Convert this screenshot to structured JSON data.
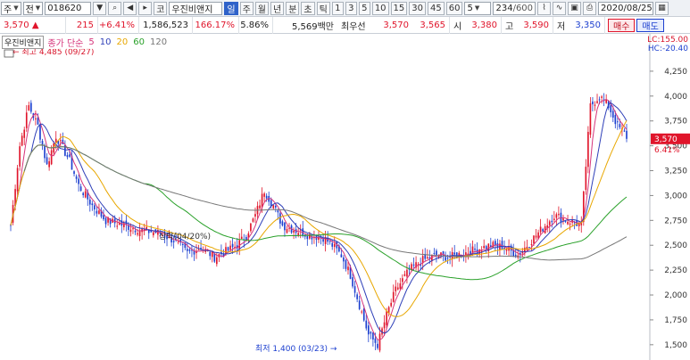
{
  "toolbar": {
    "market": "주",
    "stock_type": "전",
    "code": "018620",
    "name_prefix": "코",
    "name": "우진비앤지",
    "period_active": "일",
    "periods": [
      "주",
      "월",
      "년",
      "분",
      "초",
      "틱"
    ],
    "minutes": [
      "1",
      "3",
      "5",
      "10",
      "15",
      "30",
      "45",
      "60"
    ],
    "interval_value": "5",
    "count": "234",
    "count_total": "/600",
    "date": "2020/08/25"
  },
  "quote": {
    "price": "3,570",
    "direction": "▲",
    "change": "215",
    "change_pct": "+6.41%",
    "volume": "1,586,523",
    "volume_ratio": "166.17%",
    "turnover": "5.86%",
    "amount": "5,569백만",
    "best_label": "최우선",
    "ask": "3,570",
    "bid": "3,565",
    "open_label": "시",
    "open": "3,380",
    "high_label": "고",
    "high": "3,590",
    "low_label": "저",
    "low": "3,350",
    "buy_label": "매수",
    "sell_label": "매도"
  },
  "legend": {
    "name": "우진비앤지",
    "price_label": "종가 단순",
    "ma": [
      "5",
      "10",
      "20",
      "60",
      "120"
    ],
    "colors": [
      "#d6357b",
      "#2e3fb8",
      "#e8a700",
      "#2aa12a",
      "#777777"
    ]
  },
  "header_right": {
    "lc": "LC:155.00",
    "hc": "HC:-20.40"
  },
  "chart_data": {
    "type": "candlestick",
    "y_axis": [
      "4,250",
      "4,000",
      "3,750",
      "3,500",
      "3,250",
      "3,000",
      "2,750",
      "2,500",
      "2,250",
      "2,000",
      "1,750",
      "1,500"
    ],
    "ylim": [
      1400,
      4500
    ],
    "current_price": "3,570",
    "current_pct": "6.41%",
    "high_note": "최고 4,485 (09/27)",
    "low_note": "최저 1,400 (03/23)",
    "mid_note": "상락(04/20%)",
    "up_color": "#e0152b",
    "down_color": "#1c3fcf"
  }
}
